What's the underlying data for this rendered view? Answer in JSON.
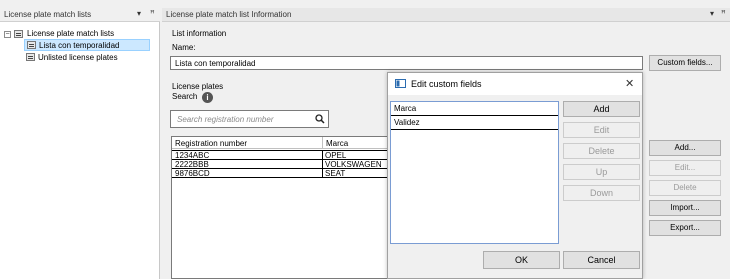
{
  "left_panel": {
    "title": "License plate match lists",
    "pin_glyph": "▾",
    "close_glyph": "ꟸ",
    "tree": {
      "root_label": "License plate match lists",
      "root_expander": "−",
      "items": [
        {
          "label": "Lista con temporalidad",
          "selected": true
        },
        {
          "label": "Unlisted license plates",
          "selected": false
        }
      ]
    }
  },
  "main_panel": {
    "title": "License plate match list Information",
    "pin_glyph": "▾",
    "close_glyph": "ꟸ",
    "list_info_label": "List information",
    "name_label": "Name:",
    "name_value": "Lista con temporalidad",
    "custom_fields_button": "Custom fields...",
    "plates_label": "License plates",
    "search_label": "Search",
    "search_placeholder": "Search registration number",
    "grid": {
      "columns": [
        "Registration number",
        "Marca"
      ],
      "rows": [
        [
          "1234ABC",
          "OPEL"
        ],
        [
          "2222BBB",
          "VOLKSWAGEN"
        ],
        [
          "9876BCD",
          "SEAT"
        ]
      ]
    },
    "buttons": {
      "add": "Add...",
      "edit": "Edit...",
      "delete": "Delete",
      "import": "Import...",
      "export": "Export..."
    }
  },
  "dialog": {
    "title": "Edit custom fields",
    "close_glyph": "✕",
    "fields": [
      "Marca",
      "Validez"
    ],
    "buttons": {
      "add": "Add",
      "edit": "Edit",
      "delete": "Delete",
      "up": "Up",
      "down": "Down",
      "ok": "OK",
      "cancel": "Cancel"
    }
  }
}
